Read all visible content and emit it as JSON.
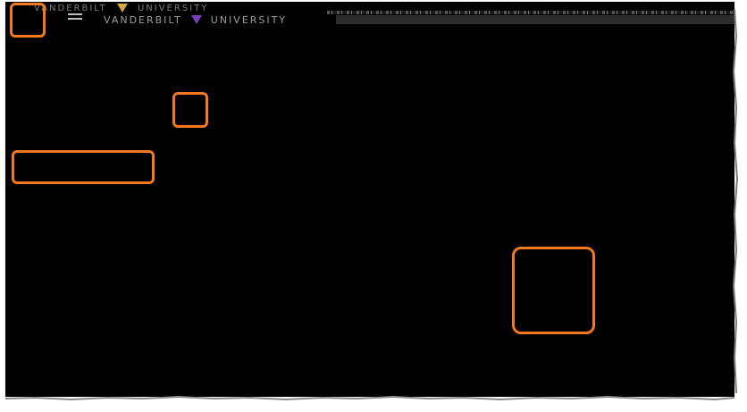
{
  "header": {
    "brand_top": "VANDERBILT",
    "brand_top_right": "UNIVERSITY",
    "brand_main": "VANDERBILT",
    "brand_main_right": "UNIVERSITY",
    "menu_icon": "hamburger-menu-icon"
  },
  "colors": {
    "background": "#000000",
    "highlight": "#f4781e",
    "brand_gold": "#c9a53a"
  }
}
